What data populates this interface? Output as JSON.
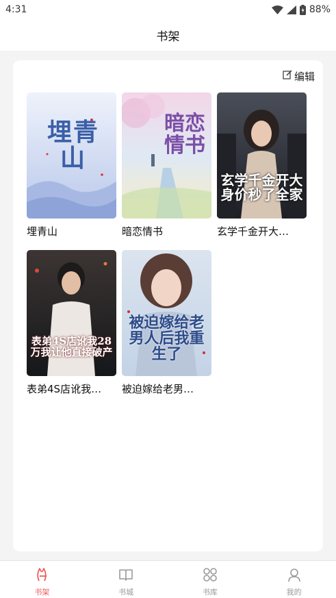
{
  "status": {
    "time": "4:31",
    "battery": "88%"
  },
  "header": {
    "title": "书架"
  },
  "toolbar": {
    "edit_label": "编辑"
  },
  "books": [
    {
      "title": "埋青山",
      "cover_text": "埋青山"
    },
    {
      "title": "暗恋情书",
      "cover_text": "暗恋情书"
    },
    {
      "title": "玄学千金开大…",
      "cover_text": "玄学千金开大身价秒了全家"
    },
    {
      "title": "表弟4S店讹我…",
      "cover_text": "表弟4S店讹我28万我让他直接破产"
    },
    {
      "title": "被迫嫁给老男…",
      "cover_text": "被迫嫁给老男人后我重生了"
    }
  ],
  "tabs": [
    {
      "label": "书架",
      "icon": "bookshelf-icon",
      "active": true
    },
    {
      "label": "书城",
      "icon": "open-book-icon",
      "active": false
    },
    {
      "label": "书库",
      "icon": "grid-icon",
      "active": false
    },
    {
      "label": "我的",
      "icon": "user-icon",
      "active": false
    }
  ],
  "colors": {
    "accent": "#f15b5b",
    "inactive": "#999999",
    "background": "#f4f4f4"
  }
}
